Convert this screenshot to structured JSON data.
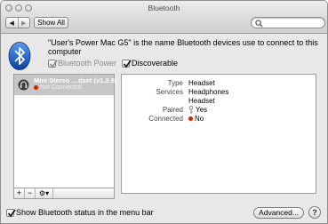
{
  "window": {
    "title": "Bluetooth"
  },
  "toolbar": {
    "back": "◀",
    "forward": "▶",
    "show_all": "Show All",
    "search_placeholder": ""
  },
  "header": {
    "owner_text": "\"User's Power Mac G5\" is the name Bluetooth devices use to connect to this computer",
    "bluetooth_power": {
      "label": "Bluetooth Power",
      "checked": true,
      "enabled": false
    },
    "discoverable": {
      "label": "Discoverable",
      "checked": true
    }
  },
  "devices": [
    {
      "name": "Mini Stereo …dset (v1.2.8)",
      "status": "Not Connected",
      "selected": true
    }
  ],
  "details": [
    {
      "label": "Type",
      "value": "Headset"
    },
    {
      "label": "Services",
      "value": "Headphones"
    },
    {
      "label": "",
      "value": "Headset"
    },
    {
      "label": "Paired",
      "value": "Yes"
    },
    {
      "label": "Connected",
      "value": "No"
    }
  ],
  "list_buttons": {
    "add": "+",
    "remove": "−",
    "action": "⚙▾"
  },
  "footer": {
    "show_status_label": "Show Bluetooth status in the menu bar",
    "show_status_checked": true,
    "advanced_label": "Advanced...",
    "help_label": "?"
  },
  "colors": {
    "status_red": "#cc2200",
    "bluetooth_blue": "#1a5fd1"
  }
}
